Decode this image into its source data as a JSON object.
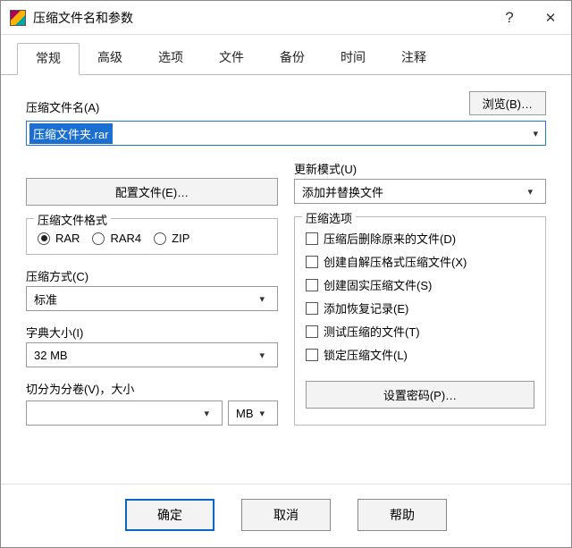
{
  "window": {
    "title": "压缩文件名和参数"
  },
  "tabs": [
    "常规",
    "高级",
    "选项",
    "文件",
    "备份",
    "时间",
    "注释"
  ],
  "labels": {
    "archive_name": "压缩文件名(A)",
    "browse": "浏览(B)…",
    "filename_value": "压缩文件夹.rar",
    "profiles": "配置文件(E)…",
    "update_mode": "更新模式(U)",
    "update_mode_value": "添加并替换文件",
    "format_group": "压缩文件格式",
    "method": "压缩方式(C)",
    "method_value": "标准",
    "dict": "字典大小(I)",
    "dict_value": "32 MB",
    "split": "切分为分卷(V)，大小",
    "split_unit": "MB",
    "options_group": "压缩选项",
    "set_password": "设置密码(P)…"
  },
  "formats": {
    "rar": "RAR",
    "rar4": "RAR4",
    "zip": "ZIP"
  },
  "options": {
    "del_after": "压缩后删除原来的文件(D)",
    "sfx": "创建自解压格式压缩文件(X)",
    "solid": "创建固实压缩文件(S)",
    "recovery": "添加恢复记录(E)",
    "test": "测试压缩的文件(T)",
    "lock": "锁定压缩文件(L)"
  },
  "buttons": {
    "ok": "确定",
    "cancel": "取消",
    "help": "帮助"
  }
}
